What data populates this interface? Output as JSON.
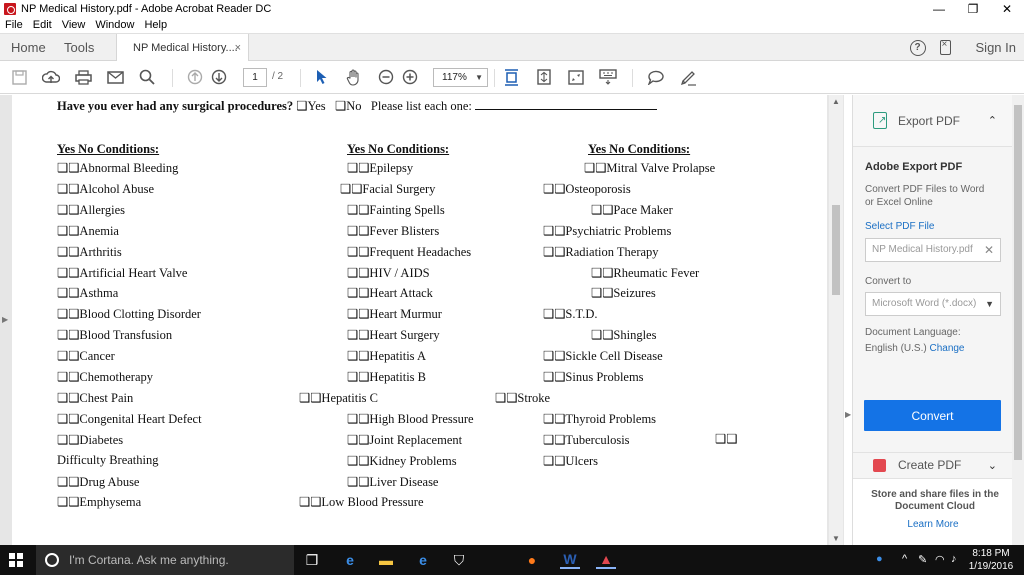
{
  "window": {
    "title": "NP Medical History.pdf - Adobe Acrobat Reader DC",
    "minimize": "—",
    "restore": "❐",
    "close": "✕"
  },
  "menu": [
    "File",
    "Edit",
    "View",
    "Window",
    "Help"
  ],
  "tabs": {
    "home": "Home",
    "tools": "Tools",
    "doc": "NP Medical History....",
    "doc_close": "×",
    "help": "?",
    "sign_in": "Sign In"
  },
  "toolbar": {
    "page_current": "1",
    "page_total": "/ 2",
    "zoom": "117%"
  },
  "document": {
    "question": "Have you ever had any surgical procedures?",
    "yes": "❑Yes",
    "no": "❑No",
    "list_prompt": "Please list each one:",
    "headers": [
      "Yes No Conditions:",
      "Yes No Conditions:",
      "Yes No Conditions:"
    ],
    "col1": [
      "❑❑Abnormal Bleeding",
      "❑❑Alcohol Abuse",
      "❑❑Allergies",
      "❑❑Anemia",
      "❑❑Arthritis",
      "❑❑Artificial Heart Valve",
      "❑❑Asthma",
      "❑❑Blood Clotting Disorder",
      "❑❑Blood Transfusion",
      "❑❑Cancer",
      "❑❑Chemotherapy",
      "❑❑Chest Pain",
      "❑❑Congenital Heart Defect",
      "❑❑Diabetes",
      "Difficulty Breathing",
      "❑❑Drug Abuse",
      "❑❑Emphysema"
    ],
    "col2": [
      "❑❑Epilepsy",
      "❑❑Facial Surgery",
      "❑❑Fainting Spells",
      "❑❑Fever Blisters",
      "❑❑Frequent Headaches",
      "❑❑HIV / AIDS",
      "❑❑Heart Attack",
      "❑❑Heart Murmur",
      "❑❑Heart Surgery",
      "❑❑Hepatitis A",
      "❑❑Hepatitis B",
      "❑❑Hepatitis C",
      "❑❑High Blood Pressure",
      "❑❑Joint Replacement",
      "❑❑Kidney Problems",
      "❑❑Liver Disease",
      "❑❑Low Blood Pressure"
    ],
    "col3": [
      "❑❑Mitral Valve Prolapse",
      "❑❑Osteoporosis",
      "❑❑Pace Maker",
      "❑❑Psychiatric Problems",
      "❑❑Radiation Therapy",
      "❑❑Rheumatic Fever",
      "❑❑Seizures",
      "❑❑S.T.D.",
      "❑❑Shingles",
      "❑❑Sickle Cell Disease",
      "❑❑Sinus Problems",
      "❑❑Stroke",
      "❑❑Thyroid Problems",
      "❑❑Tuberculosis",
      "❑❑Ulcers"
    ],
    "trailing_boxes": "❑❑"
  },
  "panel": {
    "export_title": "Export PDF",
    "adobe_export": "Adobe Export PDF",
    "description": "Convert PDF Files to Word or Excel Online",
    "select_file": "Select PDF File",
    "file_name": "NP Medical History.pdf",
    "convert_to": "Convert to",
    "format": "Microsoft Word (*.docx)",
    "doc_language_label": "Document Language:",
    "doc_language": "English (U.S.)",
    "change": "Change",
    "convert_button": "Convert",
    "create_pdf": "Create PDF",
    "store_text": "Store and share files in the Document Cloud",
    "learn_more": "Learn More"
  },
  "taskbar": {
    "cortana": "I'm Cortana. Ask me anything.",
    "time": "8:18 PM",
    "date": "1/19/2016"
  }
}
